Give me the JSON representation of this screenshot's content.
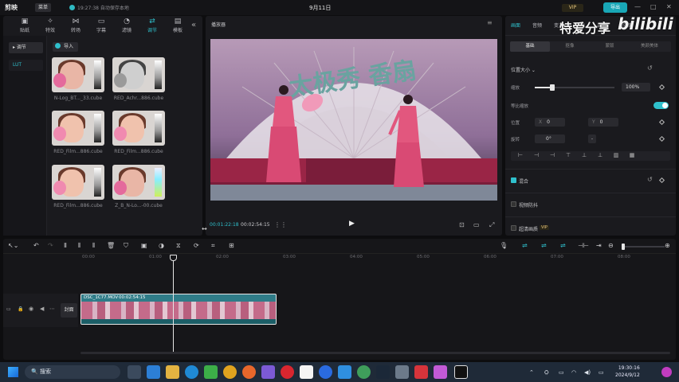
{
  "window": {
    "logo": "剪映",
    "menu_label": "菜单",
    "save_status": "19:27:38 自动保存本地",
    "title": "9月11日",
    "vip": "VIP",
    "export_label": "导出"
  },
  "left_panel": {
    "tools": [
      {
        "icon": "▣",
        "label": "贴纸"
      },
      {
        "icon": "✧",
        "label": "特效"
      },
      {
        "icon": "⋈",
        "label": "转场"
      },
      {
        "icon": "▭",
        "label": "字幕"
      },
      {
        "icon": "◔",
        "label": "滤镜"
      },
      {
        "icon": "⇄",
        "label": "调节"
      },
      {
        "icon": "▤",
        "label": "模板"
      }
    ],
    "active_tool": "调节",
    "side_items": [
      {
        "label": "▸ 调节"
      },
      {
        "label": "LUT"
      }
    ],
    "import_label": "导入",
    "luts": [
      {
        "name": "N-Log_BT..._33.cube",
        "style": "warm"
      },
      {
        "name": "RED_Achr...886.cube",
        "style": "gray"
      },
      {
        "name": "RED_Film...886.cube",
        "style": "warm"
      },
      {
        "name": "RED_Film...886.cube",
        "style": "warm"
      },
      {
        "name": "RED_Film...886.cube",
        "style": "warm"
      },
      {
        "name": "Z_B_N-Lo...-00.cube",
        "style": "cyan"
      }
    ]
  },
  "player": {
    "title": "播放器",
    "current_time": "00:01:22:18",
    "total_time": "00:02:54:15",
    "banner_text": "太极秀 香扇"
  },
  "right_panel": {
    "tabs": [
      "画面",
      "音频",
      "变速",
      "动画",
      "调节",
      "AI效果"
    ],
    "active_tab": "画面",
    "subtabs": [
      "基础",
      "抠像",
      "蒙版",
      "美颜美体"
    ],
    "active_subtab": "基础",
    "position_size": "位置大小 ⌄",
    "scale_label": "缩放",
    "scale_value": "100%",
    "uniform_scale": "等比缩放",
    "position_label": "位置",
    "pos_x_key": "X",
    "pos_x": "0",
    "pos_y_key": "Y",
    "pos_y": "0",
    "rotate_label": "旋转",
    "rotate_value": "0°",
    "blend_label": "混合",
    "stabilize_label": "视频防抖",
    "super_res_label": "超清画质",
    "super_res_badge": "VIP"
  },
  "watermark": {
    "text1": "特爱分享",
    "text2": "bilibili"
  },
  "timeline": {
    "ruler": [
      "00:00",
      "01:00",
      "02:00",
      "03:00",
      "04:00",
      "05:00",
      "06:00",
      "07:00",
      "08:00"
    ],
    "cover_label": "封面",
    "clip": {
      "name": "DSC_1C77.MOV",
      "duration": "00:02:54:15"
    }
  },
  "taskbar": {
    "search_placeholder": "搜索",
    "time": "19:30:16",
    "date": "2024/9/12"
  },
  "colors": {
    "accent": "#2fc0cc",
    "panel": "#1a1a1e",
    "background": "#0d0d0f"
  }
}
